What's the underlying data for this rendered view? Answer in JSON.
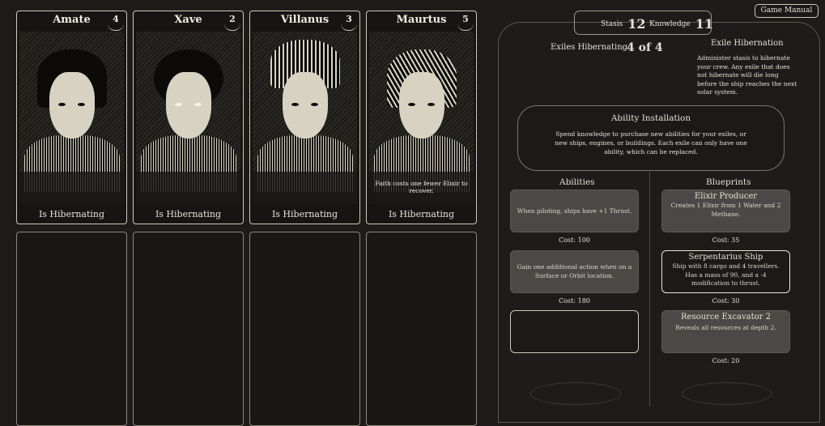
{
  "manual_button": "Game Manual",
  "stats": {
    "stasis_label": "Stasis",
    "stasis_value": "12",
    "knowledge_label": "Knowledge",
    "knowledge_value": "11"
  },
  "exiles": [
    {
      "name": "Amate",
      "number": "4",
      "status": "Is Hibernating",
      "note": ""
    },
    {
      "name": "Xave",
      "number": "2",
      "status": "Is Hibernating",
      "note": ""
    },
    {
      "name": "Villanus",
      "number": "3",
      "status": "Is Hibernating",
      "note": ""
    },
    {
      "name": "Maurtus",
      "number": "5",
      "status": "Is Hibernating",
      "note": "Faith costs one fewer Elixir to recover."
    }
  ],
  "hibernation": {
    "count_label": "Exiles Hibernating:",
    "count_value": "4 of 4",
    "title": "Exile Hibernation",
    "description": "Administer stasis to hibernate your crew. Any exile that does not hibernate will die long before the ship reaches the next solar system."
  },
  "ability_installation": {
    "title": "Ability Installation",
    "description": "Spend knowledge to purchase new abilities for your exiles, or new ships, engines, or buildings. Each exile can only have one ability, which can be replaced."
  },
  "abilities": {
    "heading": "Abilities",
    "items": [
      {
        "title": "",
        "description": "When piloting, ships have +1 Thrust.",
        "cost": "Cost: 100"
      },
      {
        "title": "",
        "description": "Gain one additional action when on a Surface or Orbit location.",
        "cost": "Cost: 180"
      }
    ]
  },
  "blueprints": {
    "heading": "Blueprints",
    "items": [
      {
        "title": "Elixir Producer",
        "description": "Creates 1 Elixir from 1 Water and 2 Methane.",
        "cost": "Cost: 35"
      },
      {
        "title": "Serpentarius Ship",
        "description": "Ship with 8 cargo and 4 travellers. Has a mass of 90, and a -4 modification to thrust.",
        "cost": "Cost: 30"
      },
      {
        "title": "Resource Excavator 2",
        "description": "Reveals all resources at depth 2.",
        "cost": "Cost: 20"
      }
    ]
  }
}
